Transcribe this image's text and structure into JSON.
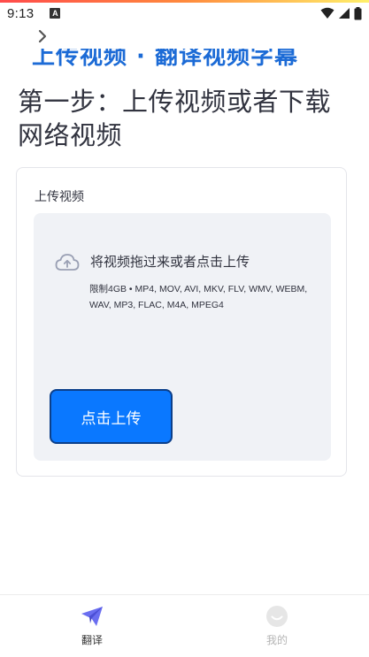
{
  "status_bar": {
    "time": "9:13",
    "notification_badge": "A",
    "icons": [
      "wifi-icon",
      "signal-icon",
      "battery-icon"
    ]
  },
  "header": {
    "back_icon": "chevron-right-icon",
    "partial_text": "上传视频 · 翻译视频字幕"
  },
  "step": {
    "title": "第一步：上传视频或者下载网络视频"
  },
  "uploader": {
    "label": "上传视频",
    "drop_text": "将视频拖过来或者点击上传",
    "limit_text": "限制4GB • MP4, MOV, AVI, MKV, FLV, WMV, WEBM, WAV, MP3, FLAC, M4A, MPEG4",
    "button_label": "点击上传",
    "icon": "cloud-upload-icon"
  },
  "bottom_nav": {
    "items": [
      {
        "label": "翻译",
        "icon": "paper-plane-icon",
        "active": true
      },
      {
        "label": "我的",
        "icon": "smiley-face-icon",
        "active": false
      }
    ]
  },
  "colors": {
    "accent": "#0a78ff",
    "nav_active": "#5b5fe0",
    "dropzone_bg": "#f0f2f6"
  }
}
